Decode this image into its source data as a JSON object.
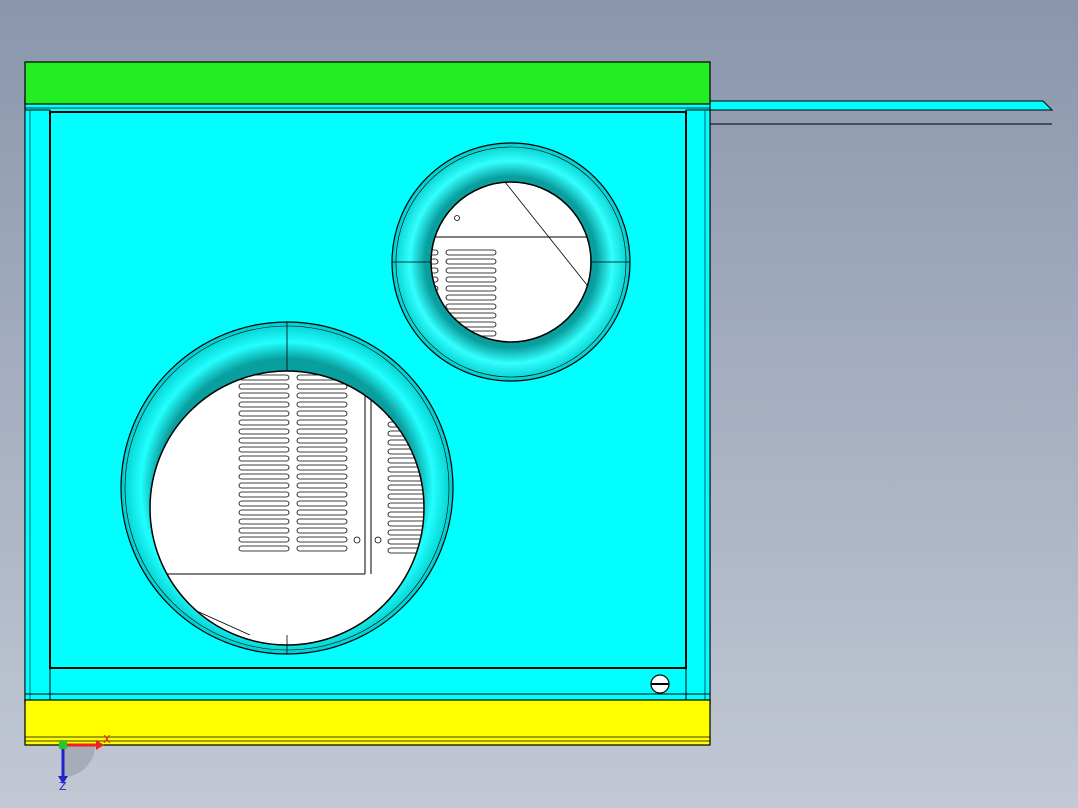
{
  "viewport": {
    "background_top": "#8996ab",
    "background_bottom": "#c2c8d4"
  },
  "model": {
    "top_frame_color": "#22ee22",
    "bottom_frame_color": "#ffff00",
    "panel_color": "#00ffff",
    "ring_color": "#11eeee",
    "interior_color": "#ffffff",
    "edge_color": "#000000"
  },
  "triad": {
    "x_label": "X",
    "z_label": "Z",
    "x_color": "#ee2222",
    "z_color": "#2222cc",
    "origin_color": "#22cc22"
  }
}
